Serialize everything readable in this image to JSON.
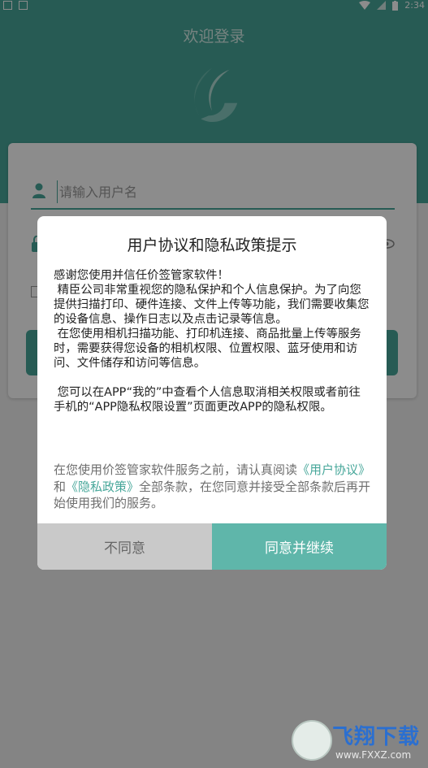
{
  "status_bar": {
    "time": "2:34"
  },
  "app": {
    "title": "欢迎登录",
    "username_placeholder": "请输入用户名"
  },
  "dialog": {
    "title": "用户协议和隐私政策提示",
    "paragraph1": "感谢您使用并信任价签管家软件！\n 精臣公司非常重视您的隐私保护和个人信息保护。为了向您提供扫描打印、硬件连接、文件上传等功能，我们需要收集您的设备信息、操作日志以及点击记录等信息。\n 在您使用相机扫描功能、打印机连接、商品批量上传等服务时，需要获得您设备的相机权限、位置权限、蓝牙使用和访问、文件储存和访问等信息。",
    "paragraph2": " 您可以在APP“我的”中查看个人信息取消相关权限或者前往手机的“APP隐私权限设置”页面更改APP的隐私权限。",
    "notice_prefix": "在您使用价签管家软件服务之前，请认真阅读",
    "link_user_agreement": "《用户协议》",
    "notice_and": "和",
    "link_privacy_policy": "《隐私政策》",
    "notice_suffix": "全部条款，在您同意并接受全部条款后再开始使用我们的服务。",
    "disagree_label": "不同意",
    "agree_label": "同意并继续"
  },
  "watermark": {
    "brand": "飞翔下载",
    "url": "www.FXXZ.com"
  },
  "colors": {
    "accent": "#47a79a",
    "agree_button": "#5fb6aa",
    "disagree_button": "#c9c9c9"
  }
}
